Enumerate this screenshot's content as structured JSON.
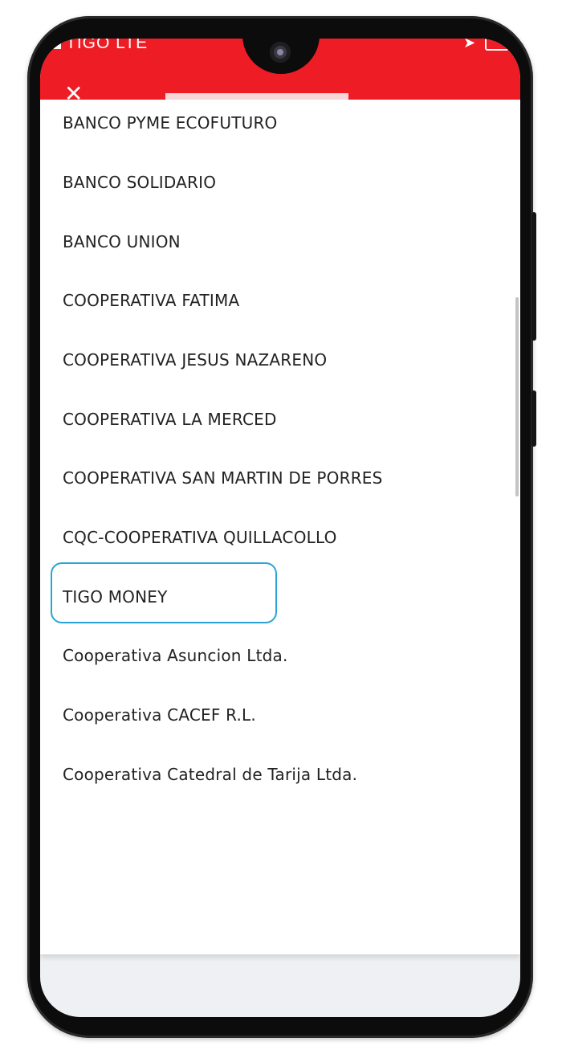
{
  "status_bar": {
    "carrier": "TIGO  LTE",
    "accent_color": "#ee1c25"
  },
  "icons": {
    "close": "close-icon",
    "location": "location-arrow-icon",
    "battery": "battery-icon"
  },
  "bank_list": {
    "items": [
      "BANCO PYME ECOFUTURO",
      "BANCO SOLIDARIO",
      "BANCO UNION",
      "COOPERATIVA FATIMA",
      "COOPERATIVA JESUS NAZARENO",
      "COOPERATIVA LA MERCED",
      "COOPERATIVA SAN MARTIN DE PORRES",
      "CQC-COOPERATIVA QUILLACOLLO",
      "TIGO MONEY",
      "Cooperativa Asuncion Ltda.",
      "Cooperativa CACEF R.L.",
      "Cooperativa Catedral de Tarija Ltda."
    ],
    "highlighted_item": "TIGO MONEY",
    "highlight_color": "#2aa4d6"
  }
}
